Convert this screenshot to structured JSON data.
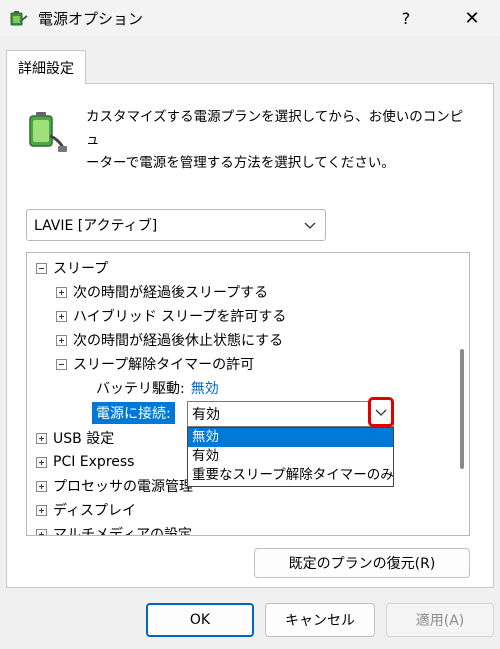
{
  "window": {
    "title": "電源オプション",
    "help_label": "?",
    "close_label": "✕"
  },
  "tab": {
    "label": "詳細設定"
  },
  "description": {
    "line1": "カスタマイズする電源プランを選択してから、お使いのコンピュ",
    "line2": "ーターで電源を管理する方法を選択してください。"
  },
  "plan_select": {
    "value": "LAVIE [アクティブ]"
  },
  "tree": {
    "sleep": {
      "label": "スリープ"
    },
    "sleep_after": {
      "label": "次の時間が経過後スリープする"
    },
    "hybrid_sleep": {
      "label": "ハイブリッド スリープを許可する"
    },
    "hibernate_after": {
      "label": "次の時間が経過後休止状態にする"
    },
    "wake_timers": {
      "label": "スリープ解除タイマーの許可"
    },
    "battery": {
      "label": "バッテリ駆動:",
      "value": "無効"
    },
    "plugged_in": {
      "label": "電源に接続:"
    },
    "usb": {
      "label": "USB 設定"
    },
    "pci": {
      "label": "PCI Express"
    },
    "cpu": {
      "label": "プロセッサの電源管理"
    },
    "display": {
      "label": "ディスプレイ"
    },
    "multimedia": {
      "label": "マルチメディアの設定"
    }
  },
  "combo": {
    "value": "有効",
    "options": [
      {
        "label": "無効",
        "highlighted": true
      },
      {
        "label": "有効",
        "highlighted": false
      },
      {
        "label": "重要なスリープ解除タイマーのみ",
        "highlighted": false
      }
    ]
  },
  "buttons": {
    "restore": "既定のプランの復元(R)",
    "ok": "OK",
    "cancel": "キャンセル",
    "apply": "適用(A)"
  },
  "colors": {
    "selection": "#0078d7",
    "link": "#0066cc",
    "highlight_box": "#e00000",
    "ok_border": "#0067c0"
  }
}
